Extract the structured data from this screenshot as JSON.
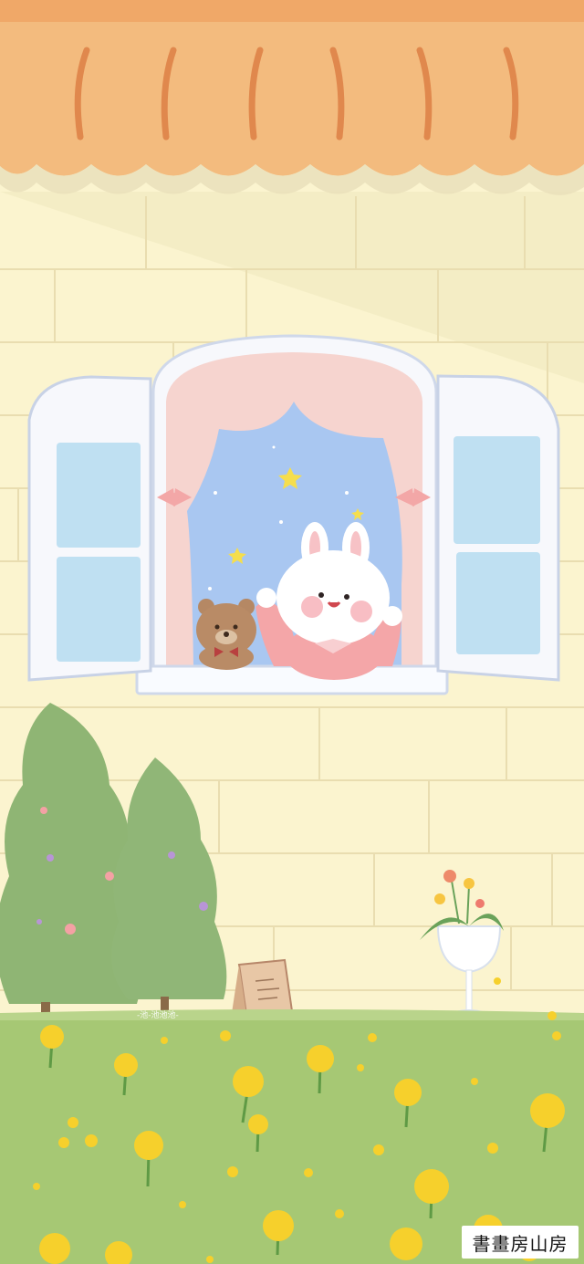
{
  "scene": {
    "description_colors": {
      "wall": "#fbf4cf",
      "awning": "#f3b97a",
      "awning_stripe": "#e68e55",
      "grass": "#a5c873",
      "tree": "#8fb574",
      "window_frame": "#f5f7fb",
      "glass": "#bfe0f2",
      "sky": "#a9c8f2",
      "curtain": "#f6d3cf",
      "bunny": "#ffffff",
      "bunny_shirt": "#f4a6a8",
      "bear": "#b58864",
      "flower": "#f6d02c",
      "sign": "#e8c7a6"
    },
    "signature": "-池-池池池-",
    "watermark": "書畫房山房"
  }
}
